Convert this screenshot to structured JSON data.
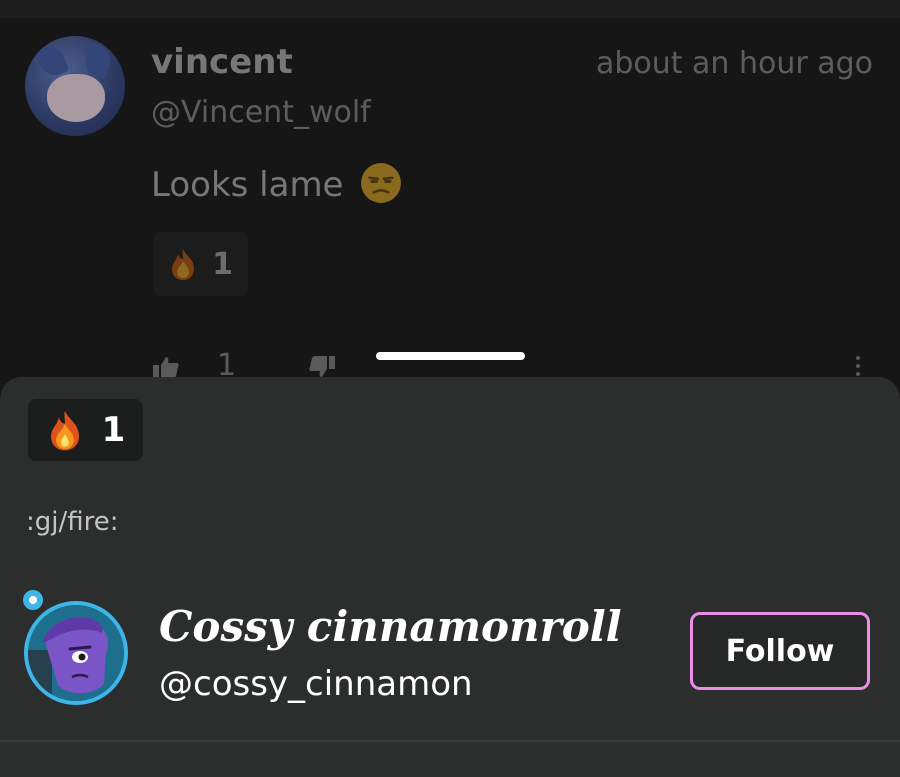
{
  "comment": {
    "author_name": "vincent",
    "author_handle": "@Vincent_wolf",
    "timestamp": "about an hour ago",
    "text": "Looks lame",
    "text_emoji": "unamused-face-icon",
    "reaction": {
      "icon": "fire-icon",
      "count": "1"
    },
    "likes": "1"
  },
  "sheet": {
    "reaction": {
      "icon": "fire-icon",
      "count": "1"
    },
    "shortcode": ":gj/fire:",
    "user": {
      "display_name": "Cossy cinnamonroll",
      "handle": "@cossy_cinnamon",
      "avatar": "purple-character-avatar"
    },
    "follow_label": "Follow"
  },
  "colors": {
    "background": "#161616",
    "sheet": "#2c2e2e",
    "follow_border": "#e98ee6",
    "avatar_ring": "#3fb4e6"
  }
}
